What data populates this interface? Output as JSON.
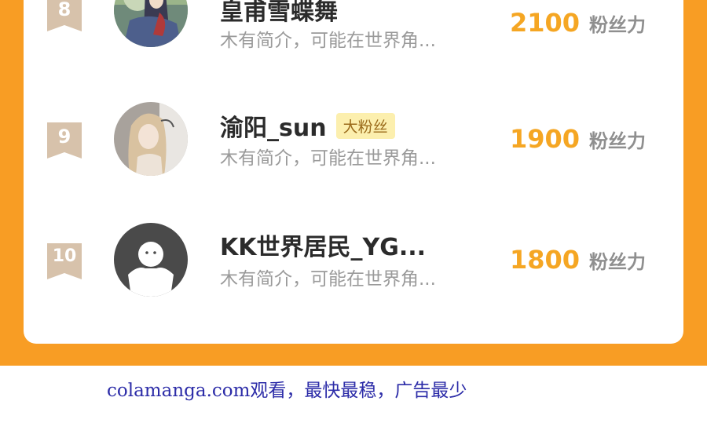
{
  "ranking": [
    {
      "rank": "8",
      "name": "皇甫雪蝶舞",
      "badge": "",
      "intro": "木有简介，可能在世界角...",
      "fans": "2100",
      "fans_label": "粉丝力",
      "avatar": "illustrated-girl-avatar"
    },
    {
      "rank": "9",
      "name": "渝阳_sun",
      "badge": "大粉丝",
      "intro": "木有简介，可能在世界角...",
      "fans": "1900",
      "fans_label": "粉丝力",
      "avatar": "photo-girl-avatar"
    },
    {
      "rank": "10",
      "name": "KK世界居民_YG...",
      "badge": "",
      "intro": "木有简介，可能在世界角...",
      "fans": "1800",
      "fans_label": "粉丝力",
      "avatar": "default-user-avatar"
    }
  ],
  "footer": {
    "text": "colamanga.com观看，最快最稳，广告最少"
  },
  "colors": {
    "frame_orange": "#f89d24",
    "fans_gold": "#f5a623",
    "badge_bg": "#fcefae",
    "rank_ribbon": "#d7c2ab",
    "footer_blue": "#2c2ca8"
  }
}
